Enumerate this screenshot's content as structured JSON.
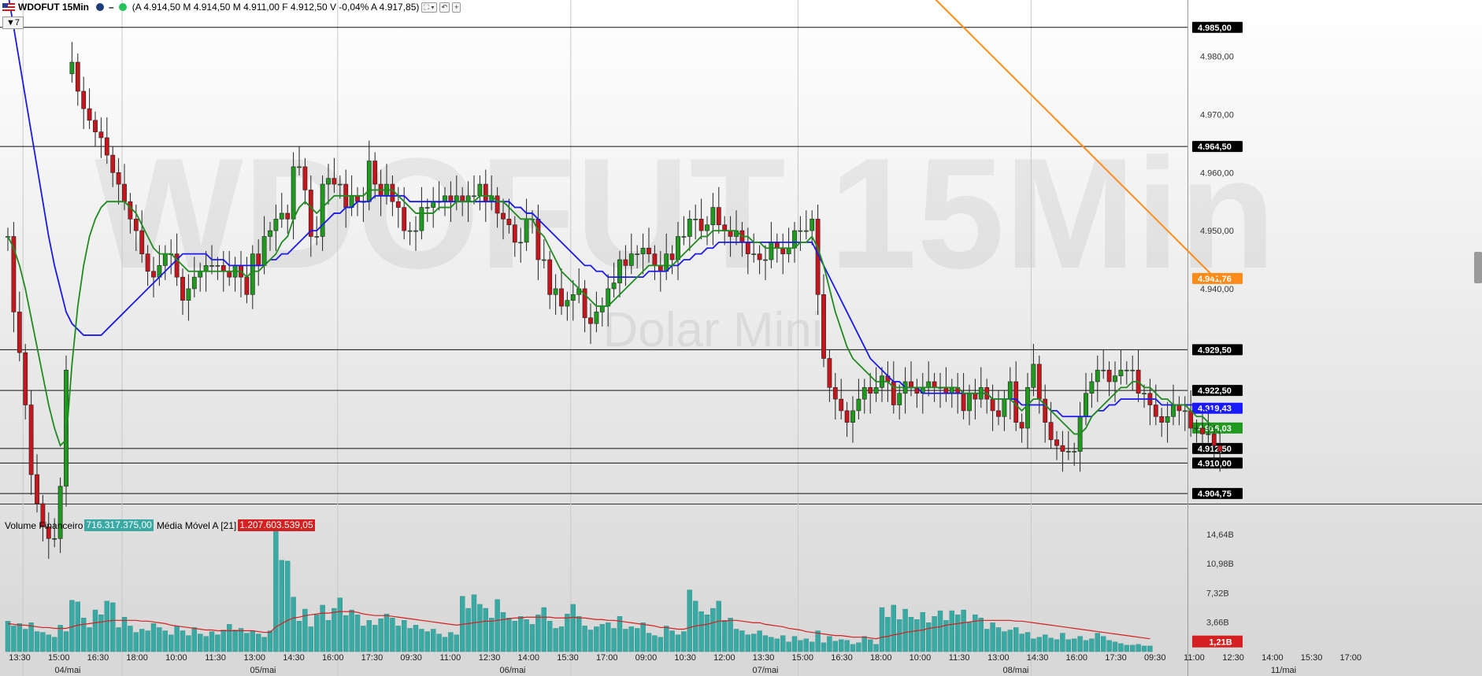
{
  "header": {
    "symbol": "WDOFUT 15Min",
    "ohlc_text": "(A 4.914,50 M 4.914,50 M 4.911,00 F 4.912,50 V -0,04% A 4.917,85)",
    "period_button": "▼7"
  },
  "watermark": {
    "symbol": "WDOFUT 15Min",
    "name": "Dolar Mini"
  },
  "price_axis": {
    "ticks": [
      {
        "value": 4980,
        "label": "4.980,00"
      },
      {
        "value": 4970,
        "label": "4.970,00"
      },
      {
        "value": 4960,
        "label": "4.960,00"
      },
      {
        "value": 4950,
        "label": "4.950,00"
      },
      {
        "value": 4940,
        "label": "4.940,00"
      }
    ],
    "range": [
      4903,
      4987
    ]
  },
  "levels": [
    {
      "value": 4985.0,
      "label": "4.985,00",
      "color": "#000000"
    },
    {
      "value": 4964.5,
      "label": "4.964,50",
      "color": "#000000"
    },
    {
      "value": 4941.76,
      "label": "4.941,76",
      "color": "#ff8c1a"
    },
    {
      "value": 4929.5,
      "label": "4.929,50",
      "color": "#000000"
    },
    {
      "value": 4922.5,
      "label": "4.922,50",
      "color": "#000000"
    },
    {
      "value": 4919.43,
      "label": "4.919,43",
      "color": "#1a1aff"
    },
    {
      "value": 4916.03,
      "label": "4.916,03",
      "color": "#1f9a1f"
    },
    {
      "value": 4912.5,
      "label": "4.912,50",
      "color": "#000000"
    },
    {
      "value": 4910.0,
      "label": "4.910,00",
      "color": "#000000"
    },
    {
      "value": 4904.75,
      "label": "4.904,75",
      "color": "#000000"
    }
  ],
  "volume_panel": {
    "legend_label": "Volume Financeiro",
    "volume_value": "716.317.375,00",
    "ma_label": "Média Móvel A [21]",
    "ma_value": "1.207.603.539,05",
    "axis": [
      {
        "value": 14.64,
        "label": "14,64B"
      },
      {
        "value": 10.98,
        "label": "10,98B"
      },
      {
        "value": 7.32,
        "label": "7,32B"
      },
      {
        "value": 3.66,
        "label": "3,66B"
      }
    ],
    "last_label": "1,21B",
    "range": [
      0,
      16.5
    ]
  },
  "time_axis": {
    "times": [
      "13:30",
      "15:00",
      "16:30",
      "18:00",
      "10:00",
      "11:30",
      "13:00",
      "14:30",
      "16:00",
      "17:30",
      "09:30",
      "11:00",
      "12:30",
      "14:00",
      "15:30",
      "17:00",
      "09:00",
      "10:30",
      "12:00",
      "13:30",
      "15:00",
      "16:30",
      "18:00",
      "10:00",
      "11:30",
      "13:00",
      "14:30",
      "16:00",
      "17:30",
      "09:30",
      "11:00",
      "12:30",
      "14:00",
      "15:30",
      "17:00"
    ],
    "dates": [
      {
        "label": "04/mai",
        "bar": 1
      },
      {
        "label": "05/mai",
        "bar": 37
      },
      {
        "label": "06/mai",
        "bar": 77
      },
      {
        "label": "07/mai",
        "bar": 117
      },
      {
        "label": "08/mai",
        "bar": 157
      },
      {
        "label": "11/mai",
        "bar": 199
      }
    ],
    "date_separators": [
      3,
      20,
      57,
      97,
      136,
      176
    ]
  },
  "colors": {
    "up": "#1f9a1f",
    "down": "#c4161c",
    "ma_short": "#1f8a1f",
    "ma_mid": "#1a1ae6",
    "ma_long": "#ff8c1a",
    "volume": "#3aa9a3",
    "volume_ma": "#d42020"
  },
  "chart_data": {
    "type": "candlestick",
    "closes": [
      4949,
      4936,
      4929,
      4920,
      4908,
      4903,
      4899,
      4897,
      4897,
      4906,
      4926,
      4979,
      4974,
      4971,
      4969,
      4967,
      4966,
      4963,
      4960,
      4958,
      4955,
      4952,
      4950,
      4946,
      4943,
      4942,
      4944,
      4946,
      4946,
      4942,
      4938,
      4940,
      4942,
      4943,
      4944,
      4944,
      4944,
      4943,
      4942,
      4944,
      4942,
      4939,
      4946,
      4944,
      4949,
      4950,
      4952,
      4953,
      4952,
      4961,
      4961,
      4957,
      4949,
      4949,
      4958,
      4959,
      4958,
      4958,
      4954,
      4956,
      4955,
      4955,
      4962,
      4958,
      4956,
      4958,
      4955,
      4954,
      4950,
      4950,
      4950,
      4954,
      4954,
      4955,
      4955,
      4956,
      4955,
      4956,
      4955,
      4956,
      4956,
      4958,
      4955,
      4956,
      4953,
      4952,
      4951,
      4948,
      4948,
      4952,
      4952,
      4945,
      4945,
      4939,
      4940,
      4937,
      4938,
      4939,
      4940,
      4935,
      4934,
      4936,
      4937,
      4940,
      4941,
      4945,
      4944,
      4946,
      4946,
      4947,
      4946,
      4944,
      4943,
      4946,
      4945,
      4949,
      4949,
      4952,
      4952,
      4950,
      4951,
      4954,
      4951,
      4950,
      4949,
      4950,
      4948,
      4946,
      4946,
      4945,
      4945,
      4948,
      4947,
      4946,
      4947,
      4950,
      4950,
      4950,
      4952,
      4939,
      4928,
      4923,
      4921,
      4919,
      4917,
      4919,
      4921,
      4923,
      4922,
      4923,
      4925,
      4924,
      4920,
      4922,
      4924,
      4923,
      4922,
      4923,
      4924,
      4923,
      4923,
      4922,
      4923,
      4922,
      4919,
      4922,
      4921,
      4923,
      4921,
      4919,
      4918,
      4921,
      4924,
      4917,
      4916,
      4923,
      4927,
      4921,
      4917,
      4914,
      4913,
      4912,
      4912,
      4912,
      4918,
      4922,
      4924,
      4926,
      4926,
      4924,
      4925,
      4926,
      4926,
      4926,
      4922,
      4922,
      4920,
      4918,
      4917,
      4918,
      4920,
      4919,
      4919,
      4916,
      4916,
      4915,
      4915,
      4913,
      4912
    ],
    "opens": [
      4949,
      4949,
      4936,
      4929,
      4920,
      4908,
      4903,
      4899,
      4897,
      4897,
      4906,
      4977,
      4979,
      4974,
      4971,
      4969,
      4967,
      4966,
      4963,
      4960,
      4958,
      4955,
      4952,
      4950,
      4946,
      4943,
      4942,
      4944,
      4946,
      4946,
      4942,
      4938,
      4940,
      4942,
      4943,
      4944,
      4944,
      4944,
      4943,
      4942,
      4944,
      4942,
      4939,
      4946,
      4944,
      4949,
      4950,
      4952,
      4953,
      4952,
      4961,
      4961,
      4957,
      4949,
      4949,
      4958,
      4959,
      4958,
      4958,
      4954,
      4956,
      4955,
      4955,
      4962,
      4958,
      4956,
      4958,
      4955,
      4954,
      4950,
      4950,
      4950,
      4954,
      4954,
      4955,
      4955,
      4956,
      4955,
      4956,
      4955,
      4956,
      4956,
      4958,
      4955,
      4956,
      4953,
      4952,
      4951,
      4948,
      4948,
      4952,
      4952,
      4945,
      4945,
      4939,
      4940,
      4937,
      4938,
      4939,
      4940,
      4935,
      4934,
      4936,
      4937,
      4940,
      4941,
      4945,
      4944,
      4946,
      4946,
      4947,
      4946,
      4944,
      4943,
      4946,
      4945,
      4949,
      4949,
      4952,
      4952,
      4950,
      4951,
      4954,
      4951,
      4950,
      4949,
      4950,
      4948,
      4946,
      4946,
      4945,
      4945,
      4948,
      4947,
      4946,
      4947,
      4950,
      4950,
      4950,
      4952,
      4939,
      4928,
      4923,
      4921,
      4919,
      4917,
      4919,
      4921,
      4923,
      4922,
      4923,
      4925,
      4924,
      4920,
      4922,
      4924,
      4923,
      4922,
      4923,
      4924,
      4923,
      4923,
      4922,
      4923,
      4922,
      4919,
      4922,
      4921,
      4923,
      4921,
      4919,
      4918,
      4921,
      4924,
      4917,
      4916,
      4923,
      4927,
      4921,
      4917,
      4914,
      4913,
      4912,
      4912,
      4912,
      4918,
      4922,
      4924,
      4926,
      4926,
      4924,
      4925,
      4926,
      4926,
      4926,
      4922,
      4922,
      4920,
      4918,
      4917,
      4918,
      4920,
      4919,
      4919,
      4916,
      4916,
      4915,
      4915,
      4913
    ],
    "ma_short": [
      4949,
      4947,
      4944,
      4940,
      4935,
      4930,
      4925,
      4920,
      4916,
      4913,
      4914,
      4927,
      4937,
      4944,
      4949,
      4952,
      4954,
      4955,
      4955,
      4955,
      4955,
      4954,
      4953,
      4951,
      4949,
      4947,
      4946,
      4946,
      4946,
      4945,
      4944,
      4943,
      4943,
      4943,
      4943,
      4943,
      4943,
      4943,
      4943,
      4943,
      4943,
      4942,
      4943,
      4943,
      4944,
      4945,
      4946,
      4948,
      4949,
      4952,
      4954,
      4955,
      4954,
      4953,
      4954,
      4955,
      4956,
      4956,
      4956,
      4956,
      4956,
      4956,
      4957,
      4957,
      4957,
      4957,
      4957,
      4956,
      4955,
      4954,
      4953,
      4953,
      4953,
      4953,
      4954,
      4954,
      4954,
      4955,
      4955,
      4955,
      4955,
      4956,
      4956,
      4956,
      4955,
      4955,
      4954,
      4953,
      4952,
      4952,
      4952,
      4950,
      4949,
      4947,
      4945,
      4943,
      4942,
      4941,
      4940,
      4939,
      4938,
      4937,
      4937,
      4937,
      4938,
      4939,
      4940,
      4941,
      4942,
      4943,
      4944,
      4944,
      4944,
      4944,
      4944,
      4945,
      4946,
      4947,
      4948,
      4949,
      4949,
      4950,
      4950,
      4950,
      4950,
      4950,
      4949,
      4949,
      4948,
      4948,
      4947,
      4947,
      4947,
      4947,
      4947,
      4947,
      4948,
      4948,
      4949,
      4947,
      4944,
      4940,
      4936,
      4933,
      4930,
      4928,
      4927,
      4926,
      4925,
      4924,
      4924,
      4924,
      4923,
      4923,
      4923,
      4923,
      4923,
      4923,
      4923,
      4923,
      4923,
      4923,
      4923,
      4923,
      4922,
      4922,
      4922,
      4922,
      4922,
      4921,
      4921,
      4921,
      4921,
      4920,
      4919,
      4920,
      4921,
      4921,
      4920,
      4919,
      4918,
      4917,
      4916,
      4915,
      4915,
      4916,
      4918,
      4919,
      4920,
      4921,
      4922,
      4923,
      4923,
      4924,
      4924,
      4923,
      4923,
      4922,
      4921,
      4921,
      4920,
      4920,
      4920,
      4919,
      4918,
      4918,
      4917,
      4916,
      4915
    ],
    "ma_mid": [
      4991,
      4985,
      4979,
      4973,
      4967,
      4961,
      4955,
      4949,
      4944,
      4940,
      4936,
      4934,
      4933,
      4932,
      4932,
      4932,
      4932,
      4933,
      4934,
      4935,
      4936,
      4937,
      4938,
      4939,
      4940,
      4941,
      4942,
      4943,
      4944,
      4945,
      4946,
      4946,
      4946,
      4946,
      4946,
      4945,
      4945,
      4945,
      4944,
      4944,
      4944,
      4944,
      4944,
      4944,
      4944,
      4945,
      4945,
      4946,
      4946,
      4947,
      4948,
      4949,
      4950,
      4950,
      4951,
      4952,
      4953,
      4953,
      4954,
      4954,
      4955,
      4955,
      4955,
      4956,
      4956,
      4956,
      4956,
      4956,
      4956,
      4955,
      4955,
      4955,
      4955,
      4955,
      4955,
      4955,
      4955,
      4955,
      4955,
      4955,
      4955,
      4955,
      4955,
      4955,
      4955,
      4955,
      4955,
      4954,
      4954,
      4953,
      4953,
      4952,
      4951,
      4950,
      4949,
      4948,
      4947,
      4946,
      4945,
      4944,
      4944,
      4943,
      4943,
      4942,
      4942,
      4942,
      4942,
      4942,
      4942,
      4942,
      4943,
      4943,
      4943,
      4943,
      4944,
      4944,
      4945,
      4945,
      4946,
      4946,
      4947,
      4947,
      4948,
      4948,
      4948,
      4948,
      4948,
      4948,
      4948,
      4948,
      4948,
      4948,
      4948,
      4948,
      4948,
      4948,
      4948,
      4948,
      4948,
      4946,
      4944,
      4942,
      4940,
      4938,
      4936,
      4934,
      4932,
      4930,
      4928,
      4927,
      4926,
      4925,
      4924,
      4924,
      4923,
      4923,
      4923,
      4922,
      4922,
      4922,
      4922,
      4922,
      4922,
      4922,
      4922,
      4922,
      4922,
      4922,
      4922,
      4921,
      4921,
      4921,
      4921,
      4921,
      4920,
      4920,
      4920,
      4920,
      4920,
      4919,
      4919,
      4918,
      4918,
      4918,
      4918,
      4918,
      4918,
      4919,
      4919,
      4920,
      4920,
      4921,
      4921,
      4921,
      4921,
      4921,
      4921,
      4921,
      4920,
      4920,
      4920,
      4920,
      4920,
      4920,
      4920,
      4920,
      4919,
      4919
    ],
    "ma_long": [
      5020,
      5019,
      5018,
      5017,
      5016,
      5015,
      5014,
      5013,
      5012,
      5011,
      5010,
      5009,
      5008,
      5007,
      5006,
      5005,
      5004,
      5003,
      5002,
      5001,
      5000,
      4999,
      4998,
      4997,
      4996,
      4995,
      4994,
      4993,
      4992,
      4991,
      4990,
      4989,
      4988,
      4987,
      4986,
      4985,
      4984,
      4983,
      4982,
      4981,
      4980,
      4979,
      4978,
      4977,
      4976,
      4975,
      4974,
      4973,
      4972,
      4971,
      4970,
      4969,
      4968,
      4967,
      4966,
      4965,
      4964,
      4963,
      4962,
      4961,
      4960,
      4959,
      4958,
      4957,
      4956,
      4955,
      4954,
      4953,
      4952,
      4951,
      4950,
      4949,
      4948,
      4947,
      4946,
      4945,
      4944,
      4943,
      4942,
      4941.8
    ],
    "ma_long_start_bar": 125,
    "volumes": [
      3.8,
      3.2,
      3.5,
      2.8,
      3.6,
      2.5,
      2.4,
      2.1,
      1.8,
      3.3,
      2.5,
      6.4,
      6.2,
      4.2,
      3.0,
      5.2,
      4.6,
      6.3,
      6.1,
      3.0,
      4.3,
      3.2,
      2.4,
      2.8,
      2.6,
      3.5,
      3.0,
      2.6,
      2.1,
      3.2,
      2.6,
      2.0,
      3.0,
      2.2,
      1.9,
      2.5,
      2.1,
      2.7,
      3.4,
      2.7,
      2.9,
      2.3,
      2.6,
      2.2,
      1.8,
      2.6,
      16.0,
      11.4,
      11.3,
      6.8,
      3.8,
      5.3,
      3.1,
      4.6,
      5.8,
      3.9,
      5.4,
      6.7,
      4.5,
      5.2,
      4.6,
      3.2,
      3.9,
      3.3,
      4.1,
      4.7,
      4.2,
      3.2,
      3.9,
      2.9,
      3.3,
      2.8,
      2.5,
      2.8,
      2.2,
      1.8,
      2.4,
      2.1,
      6.9,
      5.4,
      7.1,
      5.9,
      5.4,
      4.2,
      6.5,
      4.9,
      4.2,
      3.8,
      4.4,
      4.0,
      3.4,
      4.6,
      5.5,
      3.8,
      2.9,
      3.1,
      4.7,
      5.9,
      4.4,
      3.2,
      2.7,
      3.1,
      3.4,
      3.6,
      2.9,
      4.4,
      2.8,
      3.1,
      2.9,
      3.6,
      2.3,
      2.0,
      1.8,
      3.2,
      2.6,
      2.1,
      2.5,
      7.7,
      6.3,
      5.0,
      4.6,
      5.4,
      6.3,
      3.9,
      4.2,
      2.8,
      2.6,
      2.1,
      2.2,
      2.6,
      2.0,
      1.8,
      1.6,
      2.0,
      1.2,
      1.9,
      1.4,
      1.6,
      1.2,
      2.6,
      1.1,
      1.9,
      1.3,
      1.5,
      1.4,
      0.9,
      1.1,
      1.9,
      1.5,
      0.9,
      5.5,
      4.3,
      5.8,
      4.0,
      5.3,
      4.3,
      4.0,
      4.9,
      3.6,
      4.4,
      5.1,
      3.9,
      5.1,
      4.6,
      5.2,
      3.7,
      4.6,
      4.2,
      2.8,
      3.6,
      3.0,
      2.5,
      2.7,
      3.0,
      2.2,
      2.4,
      1.6,
      1.8,
      2.1,
      1.7,
      1.5,
      2.3,
      1.5,
      1.6,
      1.9,
      1.4,
      1.6,
      2.3,
      1.9,
      1.4,
      1.2,
      1.0,
      0.8,
      0.8,
      0.9,
      0.7,
      0.7
    ],
    "volume_ma": [
      3.5,
      3.4,
      3.3,
      3.3,
      3.2,
      3.1,
      3.0,
      3.0,
      2.9,
      2.9,
      2.9,
      3.1,
      3.3,
      3.4,
      3.5,
      3.6,
      3.7,
      3.8,
      3.9,
      3.9,
      3.9,
      3.9,
      3.9,
      3.8,
      3.8,
      3.7,
      3.6,
      3.5,
      3.3,
      3.2,
      3.1,
      3.0,
      2.9,
      2.8,
      2.7,
      2.7,
      2.6,
      2.6,
      2.6,
      2.6,
      2.6,
      2.6,
      2.6,
      2.5,
      2.4,
      2.4,
      3.1,
      3.5,
      3.9,
      4.2,
      4.3,
      4.5,
      4.6,
      4.7,
      4.8,
      4.8,
      4.9,
      5.0,
      5.0,
      5.0,
      4.9,
      4.7,
      4.6,
      4.5,
      4.5,
      4.5,
      4.4,
      4.3,
      4.2,
      4.1,
      4.0,
      3.9,
      3.8,
      3.7,
      3.6,
      3.5,
      3.4,
      3.3,
      3.4,
      3.5,
      3.6,
      3.7,
      3.8,
      3.8,
      3.9,
      4.0,
      4.1,
      4.2,
      4.2,
      4.3,
      4.3,
      4.3,
      4.3,
      4.3,
      4.2,
      4.2,
      4.2,
      4.3,
      4.2,
      4.2,
      4.1,
      4.0,
      4.0,
      3.9,
      3.9,
      3.8,
      3.7,
      3.6,
      3.5,
      3.4,
      3.3,
      3.2,
      3.0,
      3.0,
      2.9,
      2.8,
      2.8,
      3.0,
      3.2,
      3.3,
      3.4,
      3.6,
      3.8,
      3.8,
      3.9,
      3.9,
      3.8,
      3.7,
      3.6,
      3.6,
      3.4,
      3.3,
      3.2,
      3.1,
      2.9,
      2.8,
      2.7,
      2.5,
      2.4,
      2.3,
      2.2,
      2.1,
      2.0,
      2.0,
      1.9,
      1.8,
      1.8,
      1.8,
      1.7,
      1.6,
      1.8,
      1.9,
      2.1,
      2.2,
      2.4,
      2.5,
      2.6,
      2.7,
      2.9,
      3.0,
      3.1,
      3.3,
      3.4,
      3.5,
      3.6,
      3.7,
      3.8,
      3.9,
      3.9,
      3.9,
      3.9,
      3.9,
      3.9,
      3.8,
      3.8,
      3.7,
      3.6,
      3.5,
      3.4,
      3.3,
      3.2,
      3.1,
      3.0,
      2.9,
      2.8,
      2.7,
      2.6,
      2.5,
      2.4,
      2.3,
      2.2,
      2.1,
      2.0,
      1.9,
      1.8,
      1.7,
      1.6
    ]
  }
}
